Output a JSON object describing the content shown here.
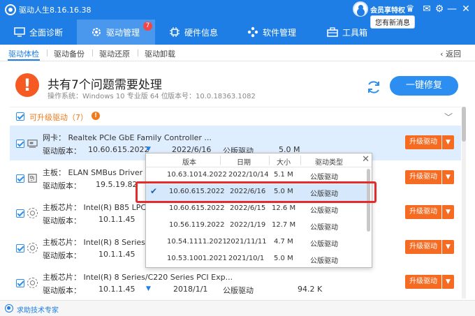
{
  "app": {
    "title": "驱动人生8.16.16.38",
    "vip_label": "会员享特权",
    "message": "您有新消息"
  },
  "nav": {
    "tabs": [
      {
        "label": "全面诊断",
        "icon": "monitor-icon"
      },
      {
        "label": "驱动管理",
        "icon": "gear-icon",
        "badge": "7"
      },
      {
        "label": "硬件信息",
        "icon": "chip-icon"
      },
      {
        "label": "软件管理",
        "icon": "apps-icon"
      },
      {
        "label": "工具箱",
        "icon": "toolbox-icon"
      }
    ]
  },
  "subnav": {
    "items": [
      "驱动体检",
      "驱动备份",
      "驱动还原",
      "驱动卸载"
    ],
    "back": "返回"
  },
  "summary": {
    "title": "共有7个问题需要处理",
    "os": "操作系统：Windows 10 专业版 64 位",
    "version": "版本号：10.0.18363.1082",
    "repair_button": "一键修复"
  },
  "section": {
    "label": "可升级驱动（7）",
    "alert": "!"
  },
  "common": {
    "ver_label": "驱动版本：",
    "upgrade_button": "升级驱动"
  },
  "rows": [
    {
      "name": "网卡：  Realtek PCIe GbE Family Controller ...",
      "version": "10.60.615.2022",
      "date": "2022/6/16",
      "type": "公版驱动",
      "size": "5.0 M",
      "icon": "network-card-icon"
    },
    {
      "name": "主板：  ELAN SMBus Driver",
      "version": "19.5.19.82",
      "date": "",
      "type": "",
      "size": "",
      "icon": "board-icon"
    },
    {
      "name": "主板芯片：  Intel(R) B85 LPC C",
      "version": "10.1.1.45",
      "date": "",
      "type": "",
      "size": "",
      "icon": "chipset-icon"
    },
    {
      "name": "主板芯片：  Intel(R) 8 Series/C",
      "version": "10.1.1.45",
      "date": "",
      "type": "",
      "size": "",
      "icon": "chipset-icon"
    },
    {
      "name": "主板芯片：  Intel(R) 8 Series/C220 Series PCI Exp...",
      "version": "10.1.1.45",
      "date": "2018/1/1",
      "type": "公版驱动",
      "size": "94.2 K",
      "icon": "chipset-icon"
    }
  ],
  "popup": {
    "headers": [
      "版本",
      "日期",
      "大小",
      "驱动类型"
    ],
    "check_mark": "✔",
    "rows": [
      {
        "version": "10.63.1014.2022",
        "date": "2022/10/14",
        "size": "5.1 M",
        "type": "公版驱动",
        "selected": false
      },
      {
        "version": "10.60.615.2022",
        "date": "2022/6/16",
        "size": "5.0 M",
        "type": "公版驱动",
        "selected": true
      },
      {
        "version": "10.60.615.2022",
        "date": "2022/6/15",
        "size": "12.6 M",
        "type": "公版驱动",
        "selected": false
      },
      {
        "version": "10.56.119.2022",
        "date": "2022/1/19",
        "size": "12.7 M",
        "type": "公版驱动",
        "selected": false
      },
      {
        "version": "10.54.1111.2021",
        "date": "2021/11/11",
        "size": "4.7 M",
        "type": "公版驱动",
        "selected": false
      },
      {
        "version": "10.53.1001.2021",
        "date": "2021/10/1",
        "size": "5.0 M",
        "type": "公版驱动",
        "selected": false
      }
    ]
  },
  "footer": {
    "help": "求助技术专家"
  },
  "colors": {
    "primary": "#1e7ee6",
    "accent": "#f56b22",
    "highlight": "#e52b2b"
  }
}
